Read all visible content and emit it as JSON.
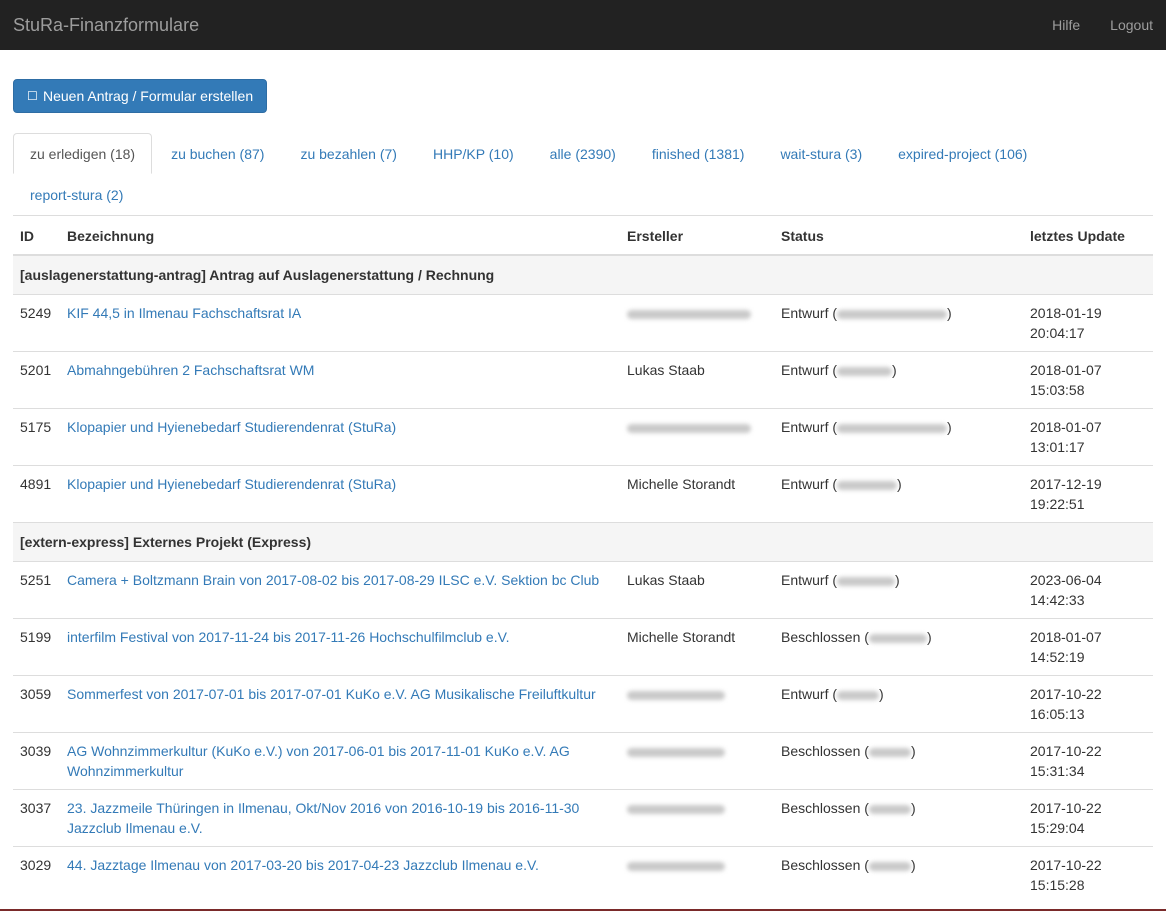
{
  "navbar": {
    "brand": "StuRa-Finanzformulare",
    "links": [
      "Hilfe",
      "Logout"
    ]
  },
  "new_button": {
    "icon": "plus-icon",
    "label": "Neuen Antrag / Formular erstellen"
  },
  "tabs": [
    {
      "label": "zu erledigen (18)",
      "active": true
    },
    {
      "label": "zu buchen (87)"
    },
    {
      "label": "zu bezahlen (7)"
    },
    {
      "label": "HHP/KP (10)"
    },
    {
      "label": "alle (2390)"
    },
    {
      "label": "finished (1381)"
    },
    {
      "label": "wait-stura (3)"
    },
    {
      "label": "expired-project (106)"
    },
    {
      "label": "report-stura (2)"
    }
  ],
  "table": {
    "headers": [
      "ID",
      "Bezeichnung",
      "Ersteller",
      "Status",
      "letztes Update"
    ],
    "groups": [
      {
        "title": "[auslagenerstattung-antrag] Antrag auf Auslagenerstattung / Rechnung",
        "rows": [
          {
            "id": "5249",
            "name": "KIF 44,5 in Ilmenau Fachschaftsrat IA",
            "creator": "",
            "status": "Entwurf",
            "date": "2018-01-19",
            "time": "20:04:17"
          },
          {
            "id": "5201",
            "name": "Abmahngebühren 2 Fachschaftsrat WM",
            "creator": "Lukas Staab",
            "status": "Entwurf",
            "date": "2018-01-07",
            "time": "15:03:58"
          },
          {
            "id": "5175",
            "name": "Klopapier und Hyienebedarf Studierendenrat (StuRa)",
            "creator": "",
            "status": "Entwurf",
            "date": "2018-01-07",
            "time": "13:01:17"
          },
          {
            "id": "4891",
            "name": "Klopapier und Hyienebedarf Studierendenrat (StuRa)",
            "creator": "Michelle Storandt",
            "status": "Entwurf",
            "date": "2017-12-19",
            "time": "19:22:51"
          }
        ]
      },
      {
        "title": "[extern-express] Externes Projekt (Express)",
        "rows": [
          {
            "id": "5251",
            "name": "Camera + Boltzmann Brain von 2017-08-02 bis 2017-08-29 ILSC e.V. Sektion bc Club",
            "creator": "Lukas Staab",
            "status": "Entwurf",
            "date": "2023-06-04",
            "time": "14:42:33"
          },
          {
            "id": "5199",
            "name": "interfilm Festival von 2017-11-24 bis 2017-11-26 Hochschulfilmclub e.V.",
            "creator": "Michelle Storandt",
            "status": "Beschlossen",
            "date": "2018-01-07",
            "time": "14:52:19"
          },
          {
            "id": "3059",
            "name": "Sommerfest von 2017-07-01 bis 2017-07-01 KuKo e.V. AG Musikalische Freiluftkultur",
            "creator": "",
            "status": "Entwurf",
            "date": "2017-10-22",
            "time": "16:05:13"
          },
          {
            "id": "3039",
            "name": "AG Wohnzimmerkultur (KuKo e.V.) von 2017-06-01 bis 2017-11-01 KuKo e.V. AG Wohnzimmerkultur",
            "creator": "",
            "status": "Beschlossen",
            "date": "2017-10-22",
            "time": "15:31:34"
          },
          {
            "id": "3037",
            "name": "23. Jazzmeile Thüringen in Ilmenau, Okt/Nov 2016 von 2016-10-19 bis 2016-11-30 Jazzclub Ilmenau e.V.",
            "creator": "",
            "status": "Beschlossen",
            "date": "2017-10-22",
            "time": "15:29:04"
          },
          {
            "id": "3029",
            "name": "44. Jazztage Ilmenau von 2017-03-20 bis 2017-04-23 Jazzclub Ilmenau e.V.",
            "creator": "",
            "status": "Beschlossen",
            "date": "2017-10-22",
            "time": "15:15:28"
          }
        ]
      }
    ]
  },
  "colors": {
    "navbar_bg": "#222222",
    "primary": "#337ab7",
    "group_bg": "#f5f5f5"
  }
}
